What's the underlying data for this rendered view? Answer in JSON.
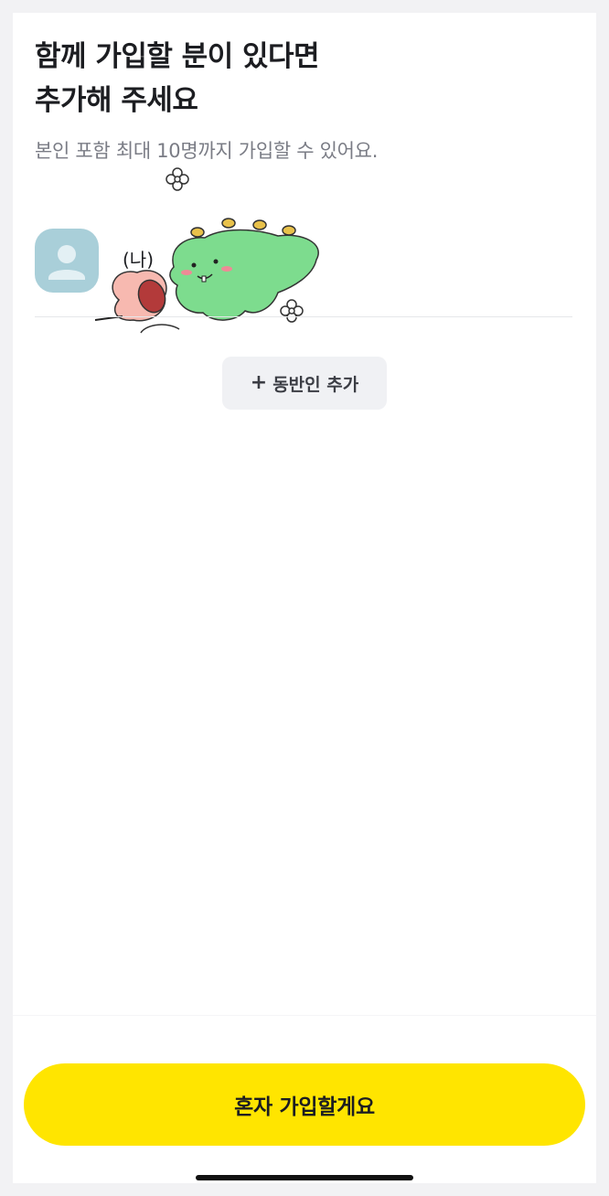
{
  "header": {
    "title_line1": "함께 가입할 분이 있다면",
    "title_line2": "추가해 주세요",
    "subtitle": "본인 포함 최대 10명까지 가입할 수 있어요."
  },
  "members": [
    {
      "label": "(나)",
      "avatar_icon": "user-silhouette-icon"
    }
  ],
  "sticker": {
    "description_icon": "dragon-and-peach-sticker-icon"
  },
  "actions": {
    "add_companion_label": "동반인 추가",
    "add_icon": "plus-icon",
    "join_alone_label": "혼자 가입할게요"
  },
  "colors": {
    "accent": "#ffe500",
    "avatar_bg": "#a9cfd9",
    "secondary_button_bg": "#f0f1f4",
    "title_text": "#1c1d21",
    "subtitle_text": "#7a7c85"
  }
}
